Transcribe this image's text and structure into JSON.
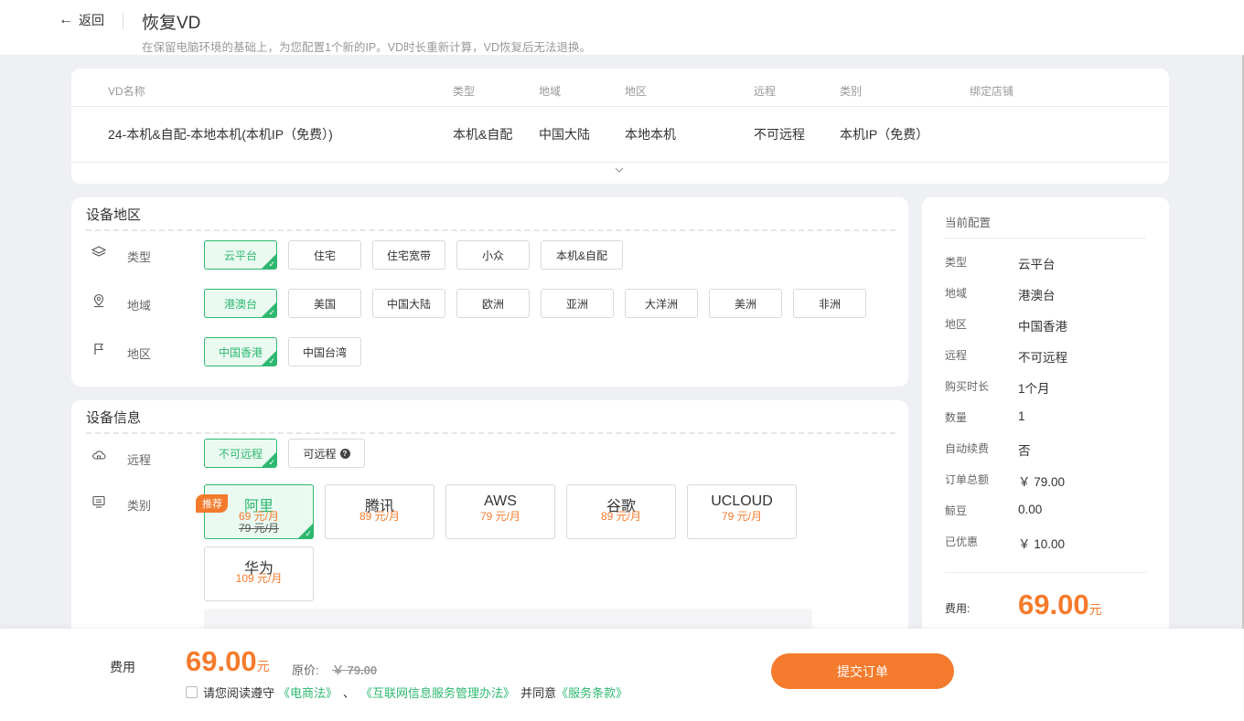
{
  "header": {
    "back_label": "返回",
    "title": "恢复VD",
    "subtitle": "在保留电脑环境的基础上，为您配置1个新的IP。VD时长重新计算，VD恢复后无法退换。"
  },
  "vd_table": {
    "columns": [
      "VD名称",
      "类型",
      "地域",
      "地区",
      "远程",
      "类别",
      "绑定店铺"
    ],
    "row": [
      "24-本机&自配-本地本机(本机IP（免费）)",
      "本机&自配",
      "中国大陆",
      "本地本机",
      "不可远程",
      "本机IP（免费）",
      ""
    ]
  },
  "region_section": {
    "title": "设备地区",
    "type_label": "类型",
    "type_options": [
      "云平台",
      "住宅",
      "住宅宽带",
      "小众",
      "本机&自配"
    ],
    "type_selected": "云平台",
    "domain_label": "地域",
    "domain_options": [
      "港澳台",
      "美国",
      "中国大陆",
      "欧洲",
      "亚洲",
      "大洋洲",
      "美洲",
      "非洲"
    ],
    "domain_selected": "港澳台",
    "area_label": "地区",
    "area_options": [
      "中国香港",
      "中国台湾"
    ],
    "area_selected": "中国香港"
  },
  "device_section": {
    "title": "设备信息",
    "remote_label": "远程",
    "remote_options": [
      "不可远程",
      "可远程"
    ],
    "remote_selected": "不可远程",
    "category_label": "类别",
    "recommend_badge": "推荐",
    "clouds": [
      {
        "name": "阿里",
        "price": "69 元/月",
        "original": "79 元/月",
        "selected": true
      },
      {
        "name": "腾讯",
        "price": "89 元/月",
        "original": "",
        "selected": false
      },
      {
        "name": "AWS",
        "price": "79 元/月",
        "original": "",
        "selected": false
      },
      {
        "name": "谷歌",
        "price": "89 元/月",
        "original": "",
        "selected": false
      },
      {
        "name": "UCLOUD",
        "price": "79 元/月",
        "original": "",
        "selected": false
      },
      {
        "name": "华为",
        "price": "109 元/月",
        "original": "",
        "selected": false
      }
    ]
  },
  "summary": {
    "title": "当前配置",
    "items": [
      {
        "k": "类型",
        "v": "云平台"
      },
      {
        "k": "地域",
        "v": "港澳台"
      },
      {
        "k": "地区",
        "v": "中国香港"
      },
      {
        "k": "远程",
        "v": "不可远程"
      },
      {
        "k": "购买时长",
        "v": "1个月"
      },
      {
        "k": "数量",
        "v": "1"
      },
      {
        "k": "自动续费",
        "v": "否"
      },
      {
        "k": "订单总额",
        "v": "￥ 79.00"
      },
      {
        "k": "鲸豆",
        "v": "0.00"
      },
      {
        "k": "已优惠",
        "v": "￥ 10.00"
      }
    ],
    "fee_label": "费用:",
    "fee_value": "69.00",
    "fee_unit": "元"
  },
  "bottom_bar": {
    "fee_label": "费用",
    "price": "69.00",
    "unit": "元",
    "original_label": "原价:",
    "original_price": "￥ 79.00",
    "agree_prefix": "请您阅读遵守",
    "law1": "《电商法》",
    "sep": "、",
    "law2": "《互联网信息服务管理办法》",
    "agree_mid": "并同意",
    "terms": "《服务条款》",
    "submit_label": "提交订单"
  },
  "colors": {
    "accent_green": "#2db86f",
    "accent_orange": "#f47b2d"
  }
}
